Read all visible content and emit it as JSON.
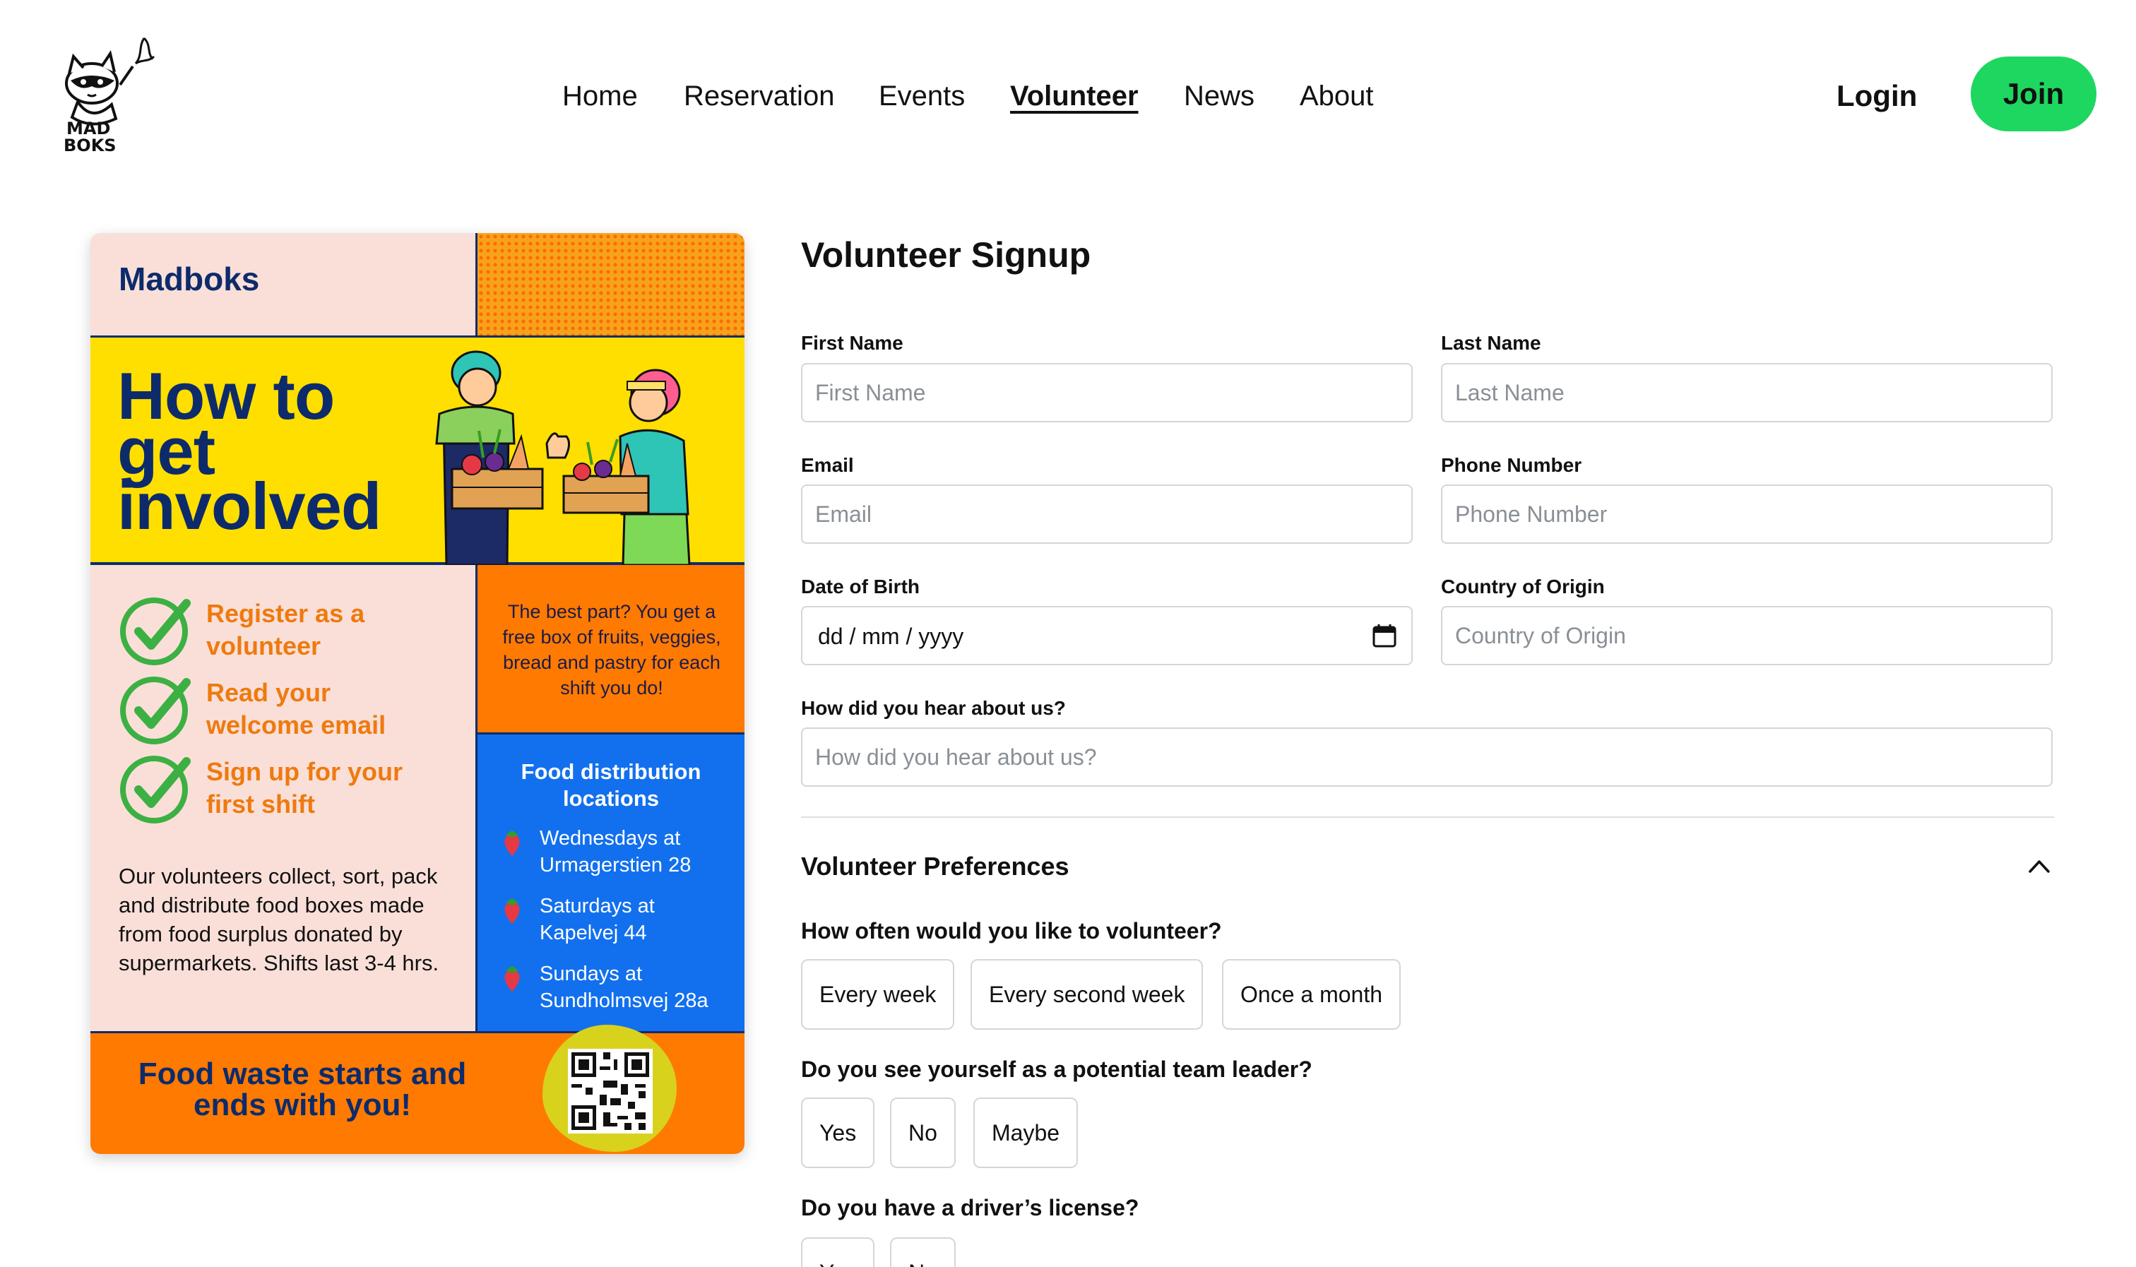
{
  "brand": {
    "logo_text_line1": "MAD",
    "logo_text_line2": "BOKS"
  },
  "nav": {
    "items": [
      {
        "label": "Home",
        "active": false
      },
      {
        "label": "Reservation",
        "active": false
      },
      {
        "label": "Events",
        "active": false
      },
      {
        "label": "Volunteer",
        "active": true
      },
      {
        "label": "News",
        "active": false
      },
      {
        "label": "About",
        "active": false
      }
    ],
    "login": "Login",
    "join": "Join",
    "join_color": "#1ed760"
  },
  "poster": {
    "brand": "Madboks",
    "hero_title_lines": [
      "How to",
      "get",
      "involved"
    ],
    "steps": [
      {
        "lines": [
          "Register as a",
          "volunteer"
        ]
      },
      {
        "lines": [
          "Read your",
          "welcome email"
        ]
      },
      {
        "lines": [
          "Sign up for your",
          "first shift"
        ]
      }
    ],
    "description": "Our volunteers collect, sort, pack and distribute food boxes made from food surplus donated by supermarkets. Shifts last 3-4 hrs.",
    "best_part": "The best part? You get a free box of fruits, veggies, bread and pastry for each shift you do!",
    "locations_title": "Food distribution locations",
    "locations": [
      {
        "line1": "Wednesdays at",
        "line2": "Urmagerstien 28"
      },
      {
        "line1": "Saturdays at",
        "line2": "Kapelvej 44"
      },
      {
        "line1": "Sundays at",
        "line2": "Sundholmsvej 28a"
      }
    ],
    "footer": "Food waste starts and ends with you!",
    "colors": {
      "navy": "#0d2b6b",
      "yellow": "#ffdf00",
      "orange": "#ff7a00",
      "blue": "#1270ee",
      "pink": "#fadfd9",
      "check_green": "#3cb043"
    }
  },
  "form": {
    "title": "Volunteer Signup",
    "first_name": {
      "label": "First Name",
      "placeholder": "First Name",
      "value": ""
    },
    "last_name": {
      "label": "Last Name",
      "placeholder": "Last Name",
      "value": ""
    },
    "email": {
      "label": "Email",
      "placeholder": "Email",
      "value": ""
    },
    "phone": {
      "label": "Phone Number",
      "placeholder": "Phone Number",
      "value": ""
    },
    "dob": {
      "label": "Date of Birth",
      "display": "dd / mm / yyyy"
    },
    "country": {
      "label": "Country of Origin",
      "placeholder": "Country of Origin",
      "value": ""
    },
    "hear": {
      "label": "How did you hear about us?",
      "placeholder": "How did you hear about us?",
      "value": ""
    },
    "preferences": {
      "title": "Volunteer Preferences",
      "expanded": true,
      "frequency": {
        "question": "How often would you like to volunteer?",
        "options": [
          "Every week",
          "Every second week",
          "Once a month"
        ]
      },
      "leader": {
        "question": "Do you see yourself as a potential team leader?",
        "options": [
          "Yes",
          "No",
          "Maybe"
        ]
      },
      "license": {
        "question": "Do you have a driver’s license?",
        "options": [
          "Yes",
          "No"
        ]
      }
    }
  }
}
